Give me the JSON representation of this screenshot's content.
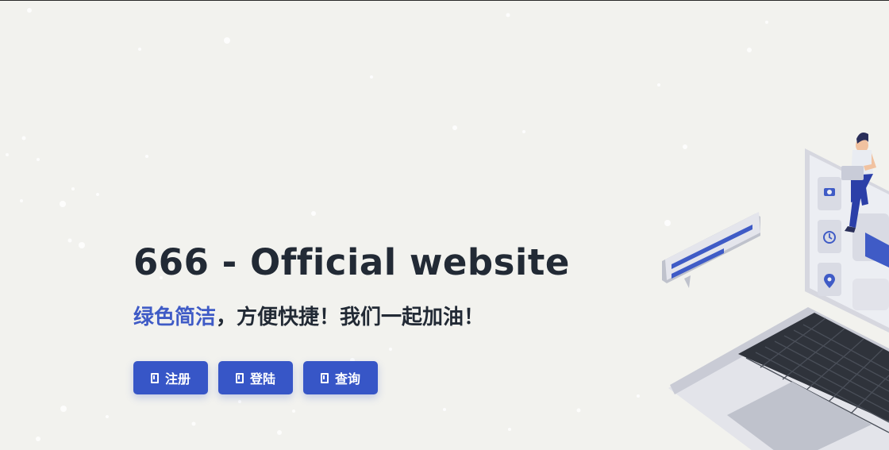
{
  "hero": {
    "title": "666 - Official website",
    "subtitle_accent": "绿色简洁",
    "subtitle_rest": "，方便快捷！我们一起加油！"
  },
  "buttons": [
    {
      "label": "注册",
      "icon": "bookmark-icon"
    },
    {
      "label": "登陆",
      "icon": "bookmark-icon"
    },
    {
      "label": "查询",
      "icon": "bookmark-icon"
    }
  ],
  "colors": {
    "background": "#f2f2ee",
    "title_text": "#222a35",
    "accent": "#3f5bc6",
    "button": "#3756c7",
    "button_text": "#ffffff"
  },
  "illustration": {
    "icons": [
      "camera-icon",
      "clock-icon",
      "location-pin-icon"
    ]
  }
}
